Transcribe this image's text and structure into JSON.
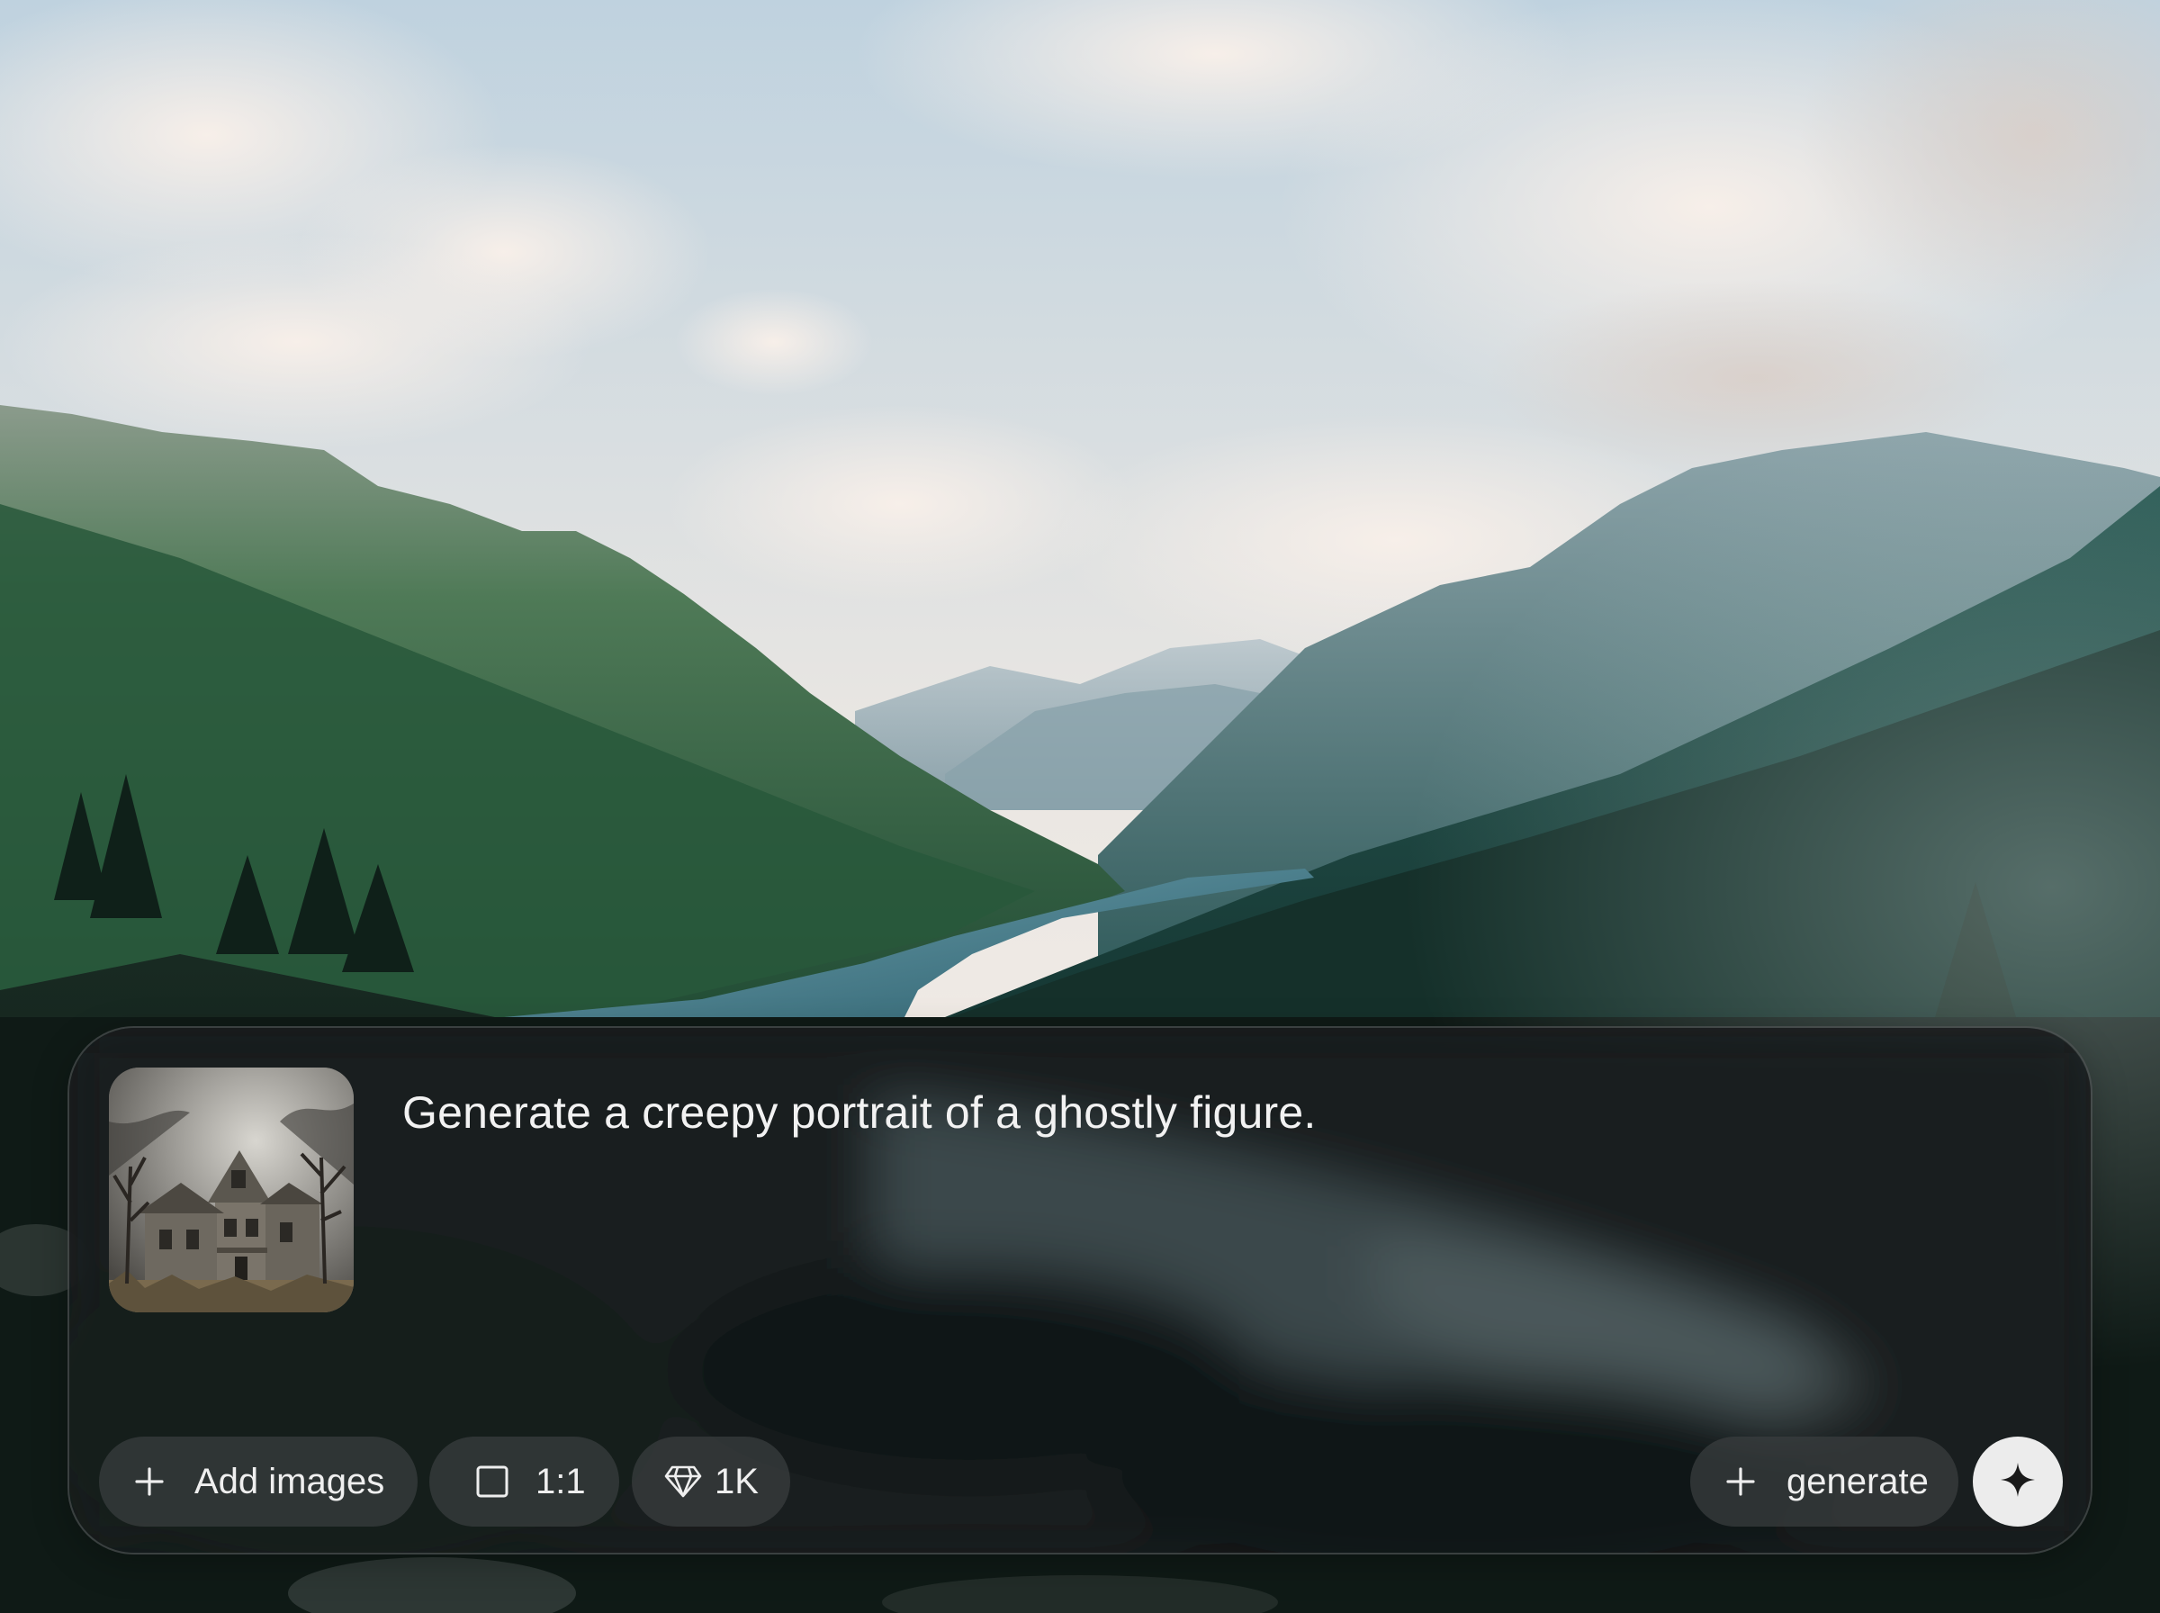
{
  "background": {
    "description_icon": "mountain-lake-landscape-image"
  },
  "prompt": {
    "text": "Generate a creepy portrait of a ghostly figure.",
    "reference_image_icon": "haunted-house-thumbnail"
  },
  "toolbar": {
    "add_images_label": "Add images",
    "aspect_ratio_label": "1:1",
    "resolution_label": "1K",
    "generate_label": "generate",
    "add_icon": "plus-icon",
    "ratio_icon": "square-icon",
    "resolution_icon": "diamond-icon",
    "send_icon": "sparkle-icon"
  },
  "colors": {
    "panel_bg": "#1a1e20",
    "pill_bg": "#3a3e40",
    "send_bg": "#ececec",
    "text": "#f2f2f2"
  }
}
